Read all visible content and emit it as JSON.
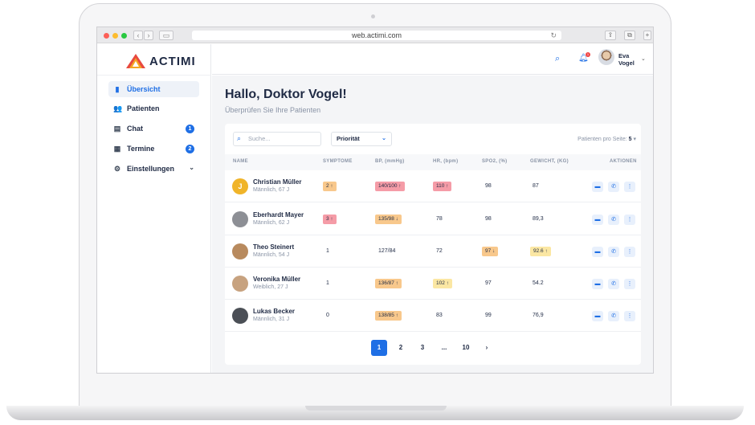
{
  "browser": {
    "url": "web.actimi.com"
  },
  "brand": {
    "name": "ACTIMI",
    "accent": "#1f6fe5",
    "logo_colors": [
      "#f5a623",
      "#e8493f"
    ]
  },
  "sidebar": {
    "items": [
      {
        "label": "Übersicht",
        "icon": "bar-chart-icon"
      },
      {
        "label": "Patienten",
        "icon": "users-icon"
      },
      {
        "label": "Chat",
        "icon": "chat-icon",
        "badge": "1"
      },
      {
        "label": "Termine",
        "icon": "calendar-icon",
        "badge": "2"
      },
      {
        "label": "Einstellungen",
        "icon": "gear-icon"
      }
    ]
  },
  "header": {
    "user_first": "Eva",
    "user_last": "Vogel",
    "notification_count": "1"
  },
  "main": {
    "greeting": "Hallo, Doktor Vogel!",
    "subtitle": "Überprüfen Sie Ihre Patienten",
    "search_placeholder": "Suche...",
    "filter": "Priorität",
    "per_page_label": "Patienten pro Seite:",
    "per_page_value": "5"
  },
  "table": {
    "columns": [
      "NAME",
      "SYMPTOME",
      "BP, (mmHg)",
      "HR, (bpm)",
      "SPO2, (%)",
      "GEWICHT, (kg)",
      "AKTIONEN"
    ],
    "rows": [
      {
        "name": "Christian Müller",
        "sub": "Männlich, 67 J",
        "initial": "J",
        "symptoms": "2 ↑",
        "bp": "140/100 ↑",
        "hr": "110 ↑",
        "spo2": "98",
        "weight": "87"
      },
      {
        "name": "Eberhardt Mayer",
        "sub": "Männlich, 62 J",
        "symptoms": "3 ↑",
        "bp": "135/98 ↓",
        "hr": "78",
        "spo2": "98",
        "weight": "89,3"
      },
      {
        "name": "Theo Steinert",
        "sub": "Männlich, 54 J",
        "symptoms": "1",
        "bp": "127/84",
        "hr": "72",
        "spo2": "97 ↓",
        "weight": "92.6 ↑"
      },
      {
        "name": "Veronika Müller",
        "sub": "Weiblich, 27 J",
        "symptoms": "1",
        "bp": "136/87 ↑",
        "hr": "102 ↑",
        "spo2": "97",
        "weight": "54.2"
      },
      {
        "name": "Lukas Becker",
        "sub": "Männlich, 31 J",
        "symptoms": "0",
        "bp": "138/85 ↑",
        "hr": "83",
        "spo2": "99",
        "weight": "76,9"
      }
    ]
  },
  "pagination": {
    "pages": [
      "1",
      "2",
      "3",
      "...",
      "10"
    ],
    "next": "›"
  }
}
